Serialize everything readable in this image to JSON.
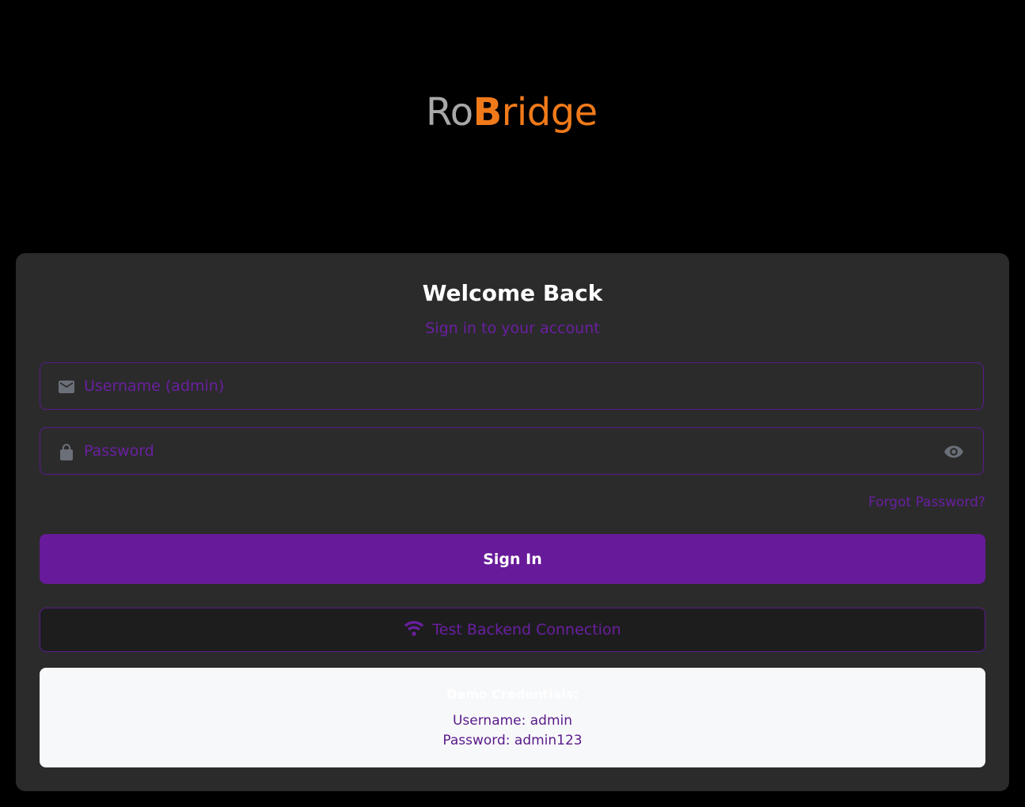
{
  "brand": {
    "logo_part_ro": "Ro",
    "logo_part_b": "B",
    "logo_part_ridge": "ridge",
    "colors": {
      "gray": "#a8a8a8",
      "orange": "#f07a1a"
    }
  },
  "login": {
    "title": "Welcome Back",
    "subtitle": "Sign in to your account",
    "username_placeholder": "Username (admin)",
    "username_icon": "mail-icon",
    "password_placeholder": "Password",
    "password_icon": "lock-icon",
    "toggle_visibility_icon": "eye-icon",
    "forgot_password": "Forgot Password?",
    "sign_in": "Sign In",
    "test_connection": "Test Backend Connection",
    "test_connection_icon": "wifi-icon"
  },
  "demo": {
    "title": "Demo Credentials:",
    "username_line": "Username: admin",
    "password_line": "Password: admin123"
  },
  "theme": {
    "background": "#000000",
    "card": "#2b2b2c",
    "accent": "#671a99",
    "accent_text": "#6a1fa0"
  }
}
